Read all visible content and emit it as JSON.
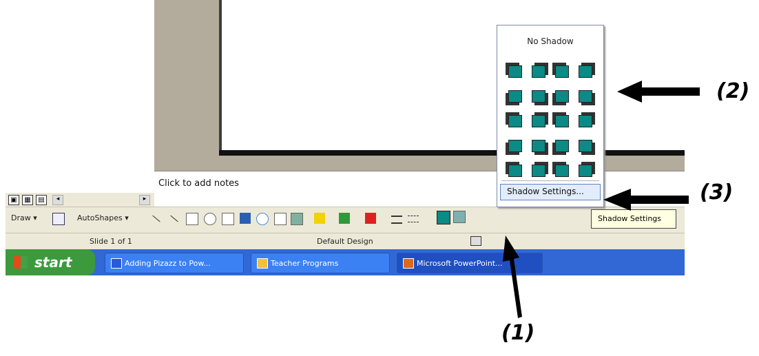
{
  "notes_placeholder": "Click to add notes",
  "draw_toolbar": {
    "draw_label": "Draw ▾",
    "autoshapes_label": "AutoShapes ▾"
  },
  "status_bar": {
    "slide_info": "Slide 1 of 1",
    "design_name": "Default Design"
  },
  "taskbar": {
    "start_label": "start",
    "tasks": [
      "Adding Pizazz to Pow...",
      "Teacher Programs",
      "Microsoft PowerPoint..."
    ]
  },
  "shadow_menu": {
    "title": "No Shadow",
    "settings_label": "Shadow Settings...",
    "rows": 5,
    "columns": 4
  },
  "tooltip": "Shadow Settings",
  "callouts": [
    "(1)",
    "(2)",
    "(3)"
  ],
  "colors": {
    "shadow_fill": "#0b8a86",
    "taskbar_blue": "#3168d5",
    "start_green": "#3c9a3c"
  }
}
